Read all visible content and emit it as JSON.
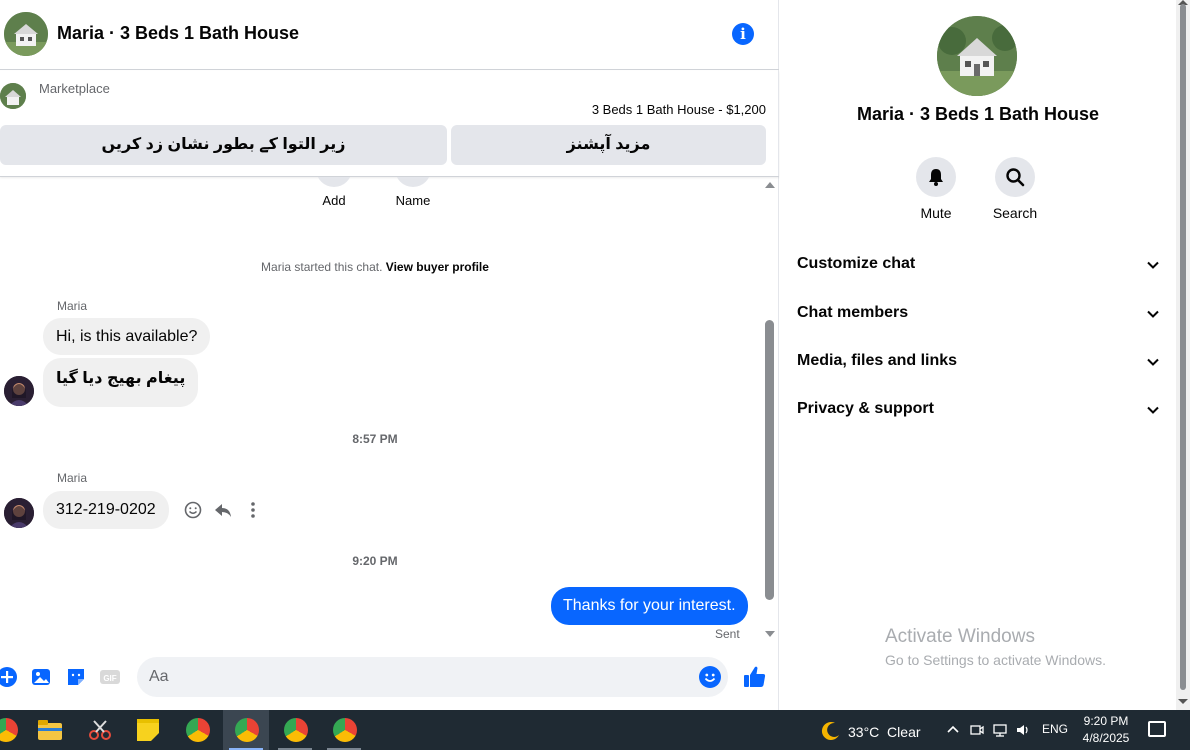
{
  "header": {
    "title": "Maria · 3 Beds 1 Bath House"
  },
  "listing": {
    "source": "Marketplace",
    "info": "3 Beds 1 Bath House - $1,200",
    "mark_button": "زیر التوا کے بطور نشان زد کریں",
    "more_button": "مزید آپشنز"
  },
  "profile_actions": {
    "add": "Add",
    "name": "Name"
  },
  "started": {
    "text": "Maria started this chat.",
    "link": "View buyer profile"
  },
  "messages": {
    "group1_sender": "Maria",
    "msg1": "Hi, is this available?",
    "msg2": "پیغام بھیج دیا گیا",
    "time1": "8:57 PM",
    "group2_sender": "Maria",
    "msg3": "312-219-0202",
    "time2": "9:20 PM",
    "msg4": "Thanks for your interest.",
    "sent_label": "Sent"
  },
  "composer": {
    "placeholder": "Aa"
  },
  "info_pane": {
    "name": "Maria · 3 Beds 1 Bath House",
    "mute": "Mute",
    "search": "Search",
    "sections": [
      "Customize chat",
      "Chat members",
      "Media, files and links",
      "Privacy & support"
    ]
  },
  "watermark": {
    "line1": "Activate Windows",
    "line2": "Go to Settings to activate Windows."
  },
  "taskbar": {
    "weather": "33°C  Clear",
    "lang": "ENG",
    "time": "9:20 PM",
    "date": "4/8/2025"
  },
  "colors": {
    "accent": "#0866ff",
    "bubble_in": "#f0f0f0",
    "taskbar": "#1f2a33"
  }
}
